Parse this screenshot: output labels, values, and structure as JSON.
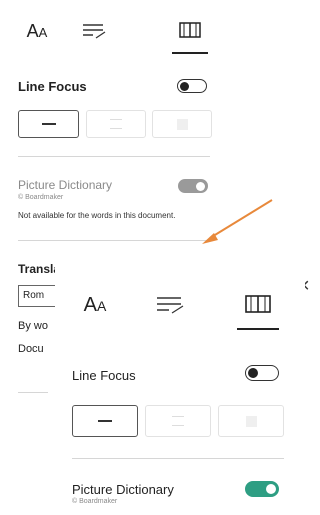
{
  "back_panel": {
    "tabs": [
      {
        "name": "text-options",
        "glyph": "AA"
      },
      {
        "name": "grammar-options",
        "glyph": "≡"
      },
      {
        "name": "reading-preferences",
        "glyph": "📖"
      }
    ],
    "line_focus_label": "Line Focus",
    "picture_dictionary_label": "Picture Dictionary",
    "boardmaker_label": "© Boardmaker",
    "not_available_text": "Not available for the words in this document.",
    "translate_label": "Translate",
    "translate_select_value": "Rom",
    "by_word_label": "By wo",
    "document_label": "Docu"
  },
  "front_panel": {
    "line_focus_label": "Line Focus",
    "picture_dictionary_label": "Picture Dictionary",
    "boardmaker_label": "© Boardmaker"
  },
  "close_glyph": "×",
  "colors": {
    "toggle_on": "#2e9e83",
    "toggle_disabled": "#9a9a9a",
    "arrow": "#e8893b"
  }
}
